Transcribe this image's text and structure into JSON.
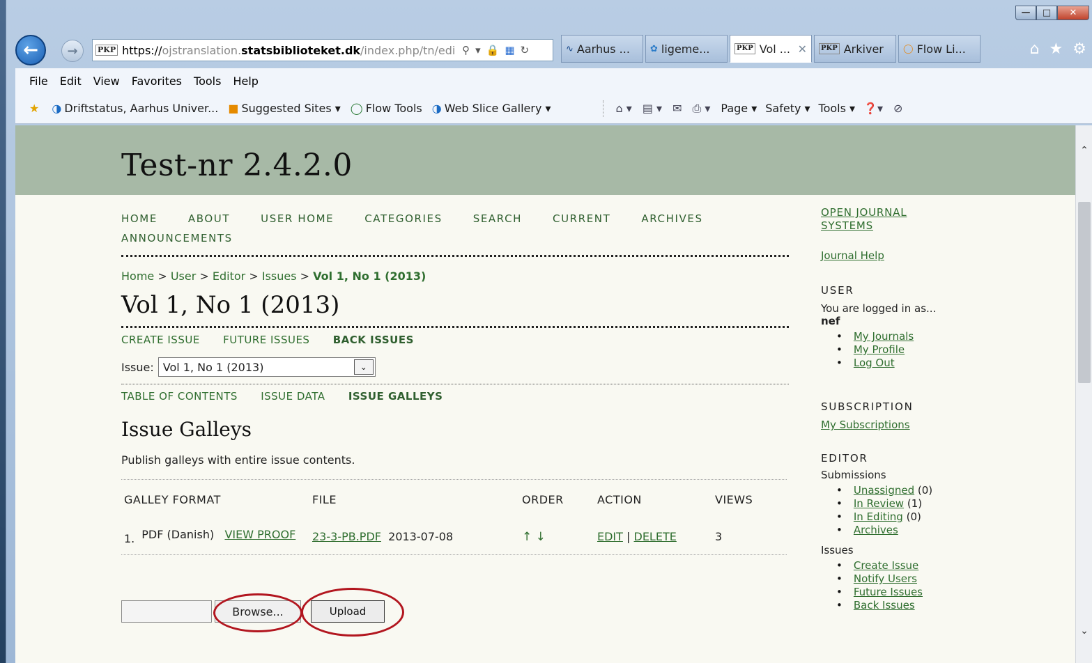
{
  "browser": {
    "address": {
      "prefix": "https://",
      "host_pre": "ojstranslation.",
      "host": "statsbiblioteket.dk",
      "path": "/index.php/tn/edi"
    },
    "tabs": [
      {
        "label": "Aarhus ...",
        "icon": "au-icon"
      },
      {
        "label": "ligeme...",
        "icon": "runner-icon"
      },
      {
        "label": "Vol ...",
        "icon": "pkp-icon",
        "active": true
      },
      {
        "label": "Arkiver",
        "icon": "pkp-icon"
      },
      {
        "label": "Flow Li...",
        "icon": "flow-icon"
      }
    ],
    "menu": [
      "File",
      "Edit",
      "View",
      "Favorites",
      "Tools",
      "Help"
    ],
    "favorites": [
      {
        "label": "Driftstatus, Aarhus Univer...",
        "icon": "ie-icon"
      },
      {
        "label": "Suggested Sites ▾",
        "icon": "suggested-icon"
      },
      {
        "label": "Flow Tools",
        "icon": "flow-icon"
      },
      {
        "label": "Web Slice Gallery ▾",
        "icon": "ie-icon"
      }
    ],
    "commands": [
      "Page ▾",
      "Safety ▾",
      "Tools ▾"
    ]
  },
  "site": {
    "title": "Test-nr 2.4.2.0"
  },
  "nav": [
    "HOME",
    "ABOUT",
    "USER HOME",
    "CATEGORIES",
    "SEARCH",
    "CURRENT",
    "ARCHIVES",
    "ANNOUNCEMENTS"
  ],
  "breadcrumb": {
    "items": [
      "Home",
      "User",
      "Editor",
      "Issues"
    ],
    "sep": ">",
    "current": "Vol 1, No 1 (2013)"
  },
  "page": {
    "title": "Vol 1, No 1 (2013)",
    "subnav": [
      "CREATE ISSUE",
      "FUTURE ISSUES",
      "BACK ISSUES"
    ],
    "issue_label": "Issue:",
    "issue_selected": "Vol 1, No 1 (2013)",
    "issue_tabs": [
      "TABLE OF CONTENTS",
      "ISSUE DATA",
      "ISSUE GALLEYS"
    ],
    "section_title": "Issue Galleys",
    "description": "Publish galleys with entire issue contents."
  },
  "table": {
    "headers": [
      "GALLEY FORMAT",
      "FILE",
      "ORDER",
      "ACTION",
      "VIEWS"
    ],
    "rows": [
      {
        "num": "1.",
        "format": "PDF (Danish)",
        "view_proof": "VIEW PROOF",
        "file": "23-3-PB.PDF",
        "date": "2013-07-08",
        "order": "↑ ↓",
        "edit": "EDIT",
        "sep": "|",
        "delete": "DELETE",
        "views": "3"
      }
    ]
  },
  "upload": {
    "browse": "Browse...",
    "upload": "Upload"
  },
  "sidebar": {
    "ojs_link": "OPEN JOURNAL SYSTEMS",
    "help": "Journal Help",
    "user_head": "USER",
    "logged_in": "You are logged in as...",
    "username": "nef",
    "user_links": [
      "My Journals",
      "My Profile",
      "Log Out"
    ],
    "sub_head": "SUBSCRIPTION",
    "sub_link": "My Subscriptions",
    "editor_head": "EDITOR",
    "submissions_label": "Submissions",
    "submissions": [
      {
        "label": "Unassigned",
        "count": "(0)"
      },
      {
        "label": "In Review",
        "count": "(1)"
      },
      {
        "label": "In Editing",
        "count": "(0)"
      },
      {
        "label": "Archives",
        "count": ""
      }
    ],
    "issues_label": "Issues",
    "issues": [
      "Create Issue",
      "Notify Users",
      "Future Issues",
      "Back Issues"
    ]
  },
  "colors": {
    "header_bg": "#a7b9a6",
    "link_green": "#2f6e2f",
    "page_bg": "#f9f9f2",
    "annotation_red": "#b2161f"
  }
}
